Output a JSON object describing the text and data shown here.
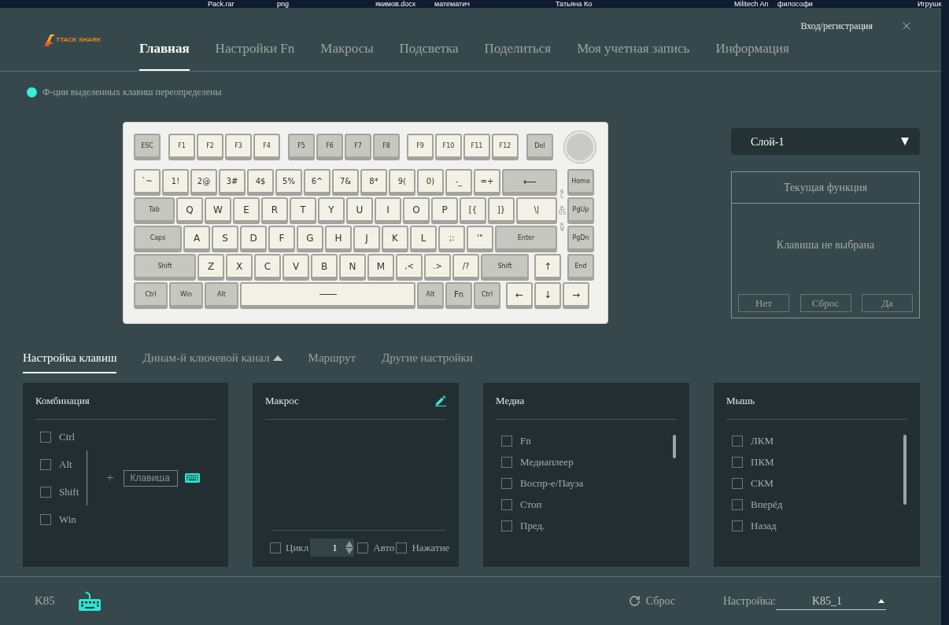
{
  "desktop": {
    "icon_labels": [
      "Pack.rar",
      "png",
      "якимов.docx",
      "математич",
      "Татьяна Ко",
      "Militech An",
      "философи",
      "Игрушк"
    ]
  },
  "header": {
    "logo": "TTACK SHARK",
    "tabs": [
      {
        "label": "Главная",
        "selected": true
      },
      {
        "label": "Настройки Fn",
        "selected": false
      },
      {
        "label": "Макросы",
        "selected": false
      },
      {
        "label": "Подсветка",
        "selected": false
      },
      {
        "label": "Поделиться",
        "selected": false
      },
      {
        "label": "Моя учетная запись",
        "selected": false
      },
      {
        "label": "Информация",
        "selected": false
      }
    ],
    "login": "Вход/регистрация"
  },
  "legend": "Ф-ции выделенных клавиш переопределены",
  "keyboard": {
    "function_row": [
      {
        "label": "ESC",
        "color": "#c7c7c1"
      },
      {
        "label": "F1",
        "color": "#f2f1e6"
      },
      {
        "label": "F2",
        "color": "#f2f1e6"
      },
      {
        "label": "F3",
        "color": "#f2f1e6"
      },
      {
        "label": "F4",
        "color": "#f2f1e6"
      },
      {
        "label": "F5",
        "color": "#c7c7c1"
      },
      {
        "label": "F6",
        "color": "#c7c7c1"
      },
      {
        "label": "F7",
        "color": "#c7c7c1"
      },
      {
        "label": "F8",
        "color": "#c7c7c1"
      },
      {
        "label": "F9",
        "color": "#f2f1e6"
      },
      {
        "label": "F10",
        "color": "#f2f1e6"
      },
      {
        "label": "F11",
        "color": "#f2f1e6"
      },
      {
        "label": "F12",
        "color": "#f2f1e6"
      },
      {
        "label": "Del",
        "color": "#c7c7c1"
      }
    ],
    "main_rows": [
      [
        {
          "label": "`~",
          "color": "#f2f1e6"
        },
        {
          "label": "1!",
          "color": "#f2f1e6"
        },
        {
          "label": "2@",
          "color": "#f2f1e6"
        },
        {
          "label": "3#",
          "color": "#f2f1e6"
        },
        {
          "label": "4$",
          "color": "#f2f1e6"
        },
        {
          "label": "5%",
          "color": "#f2f1e6"
        },
        {
          "label": "6^",
          "color": "#f2f1e6"
        },
        {
          "label": "7&",
          "color": "#f2f1e6"
        },
        {
          "label": "8*",
          "color": "#f2f1e6"
        },
        {
          "label": "9(",
          "color": "#f2f1e6"
        },
        {
          "label": "0)",
          "color": "#f2f1e6"
        },
        {
          "label": "-_",
          "color": "#f2f1e6"
        },
        {
          "label": "=+",
          "color": "#f2f1e6"
        },
        {
          "label": "⟵",
          "color": "#c7c7c1"
        }
      ],
      [
        {
          "label": "Tab",
          "color": "#c7c7c1"
        },
        {
          "label": "Q",
          "color": "#f2f1e6"
        },
        {
          "label": "W",
          "color": "#f2f1e6"
        },
        {
          "label": "E",
          "color": "#f2f1e6"
        },
        {
          "label": "R",
          "color": "#f2f1e6"
        },
        {
          "label": "T",
          "color": "#f2f1e6"
        },
        {
          "label": "Y",
          "color": "#f2f1e6"
        },
        {
          "label": "U",
          "color": "#f2f1e6"
        },
        {
          "label": "I",
          "color": "#f2f1e6"
        },
        {
          "label": "O",
          "color": "#f2f1e6"
        },
        {
          "label": "P",
          "color": "#f2f1e6"
        },
        {
          "label": "[{",
          "color": "#f2f1e6"
        },
        {
          "label": "]}",
          "color": "#f2f1e6"
        },
        {
          "label": "\\|",
          "color": "#f2f1e6"
        }
      ],
      [
        {
          "label": "Caps",
          "color": "#c7c7c1"
        },
        {
          "label": "A",
          "color": "#f2f1e6"
        },
        {
          "label": "S",
          "color": "#f2f1e6"
        },
        {
          "label": "D",
          "color": "#f2f1e6"
        },
        {
          "label": "F",
          "color": "#f2f1e6"
        },
        {
          "label": "G",
          "color": "#f2f1e6"
        },
        {
          "label": "H",
          "color": "#f2f1e6"
        },
        {
          "label": "J",
          "color": "#f2f1e6"
        },
        {
          "label": "K",
          "color": "#f2f1e6"
        },
        {
          "label": "L",
          "color": "#f2f1e6"
        },
        {
          "label": ";:",
          "color": "#f2f1e6"
        },
        {
          "label": "'\"",
          "color": "#f2f1e6"
        },
        {
          "label": "Enter",
          "color": "#c7c7c1"
        }
      ],
      [
        {
          "label": "Shift",
          "color": "#c7c7c1"
        },
        {
          "label": "Z",
          "color": "#f2f1e6"
        },
        {
          "label": "X",
          "color": "#f2f1e6"
        },
        {
          "label": "C",
          "color": "#f2f1e6"
        },
        {
          "label": "V",
          "color": "#f2f1e6"
        },
        {
          "label": "B",
          "color": "#f2f1e6"
        },
        {
          "label": "N",
          "color": "#f2f1e6"
        },
        {
          "label": "M",
          "color": "#f2f1e6"
        },
        {
          "label": ",<",
          "color": "#f2f1e6"
        },
        {
          "label": ".>",
          "color": "#f2f1e6"
        },
        {
          "label": "/?",
          "color": "#f2f1e6"
        },
        {
          "label": "Shift",
          "color": "#c7c7c1"
        }
      ],
      [
        {
          "label": "Ctrl",
          "color": "#c7c7c1"
        },
        {
          "label": "Win",
          "color": "#c7c7c1"
        },
        {
          "label": "Alt",
          "color": "#c7c7c1"
        },
        {
          "color": "#f2f1e6"
        },
        {
          "label": "Alt",
          "color": "#c7c7c1"
        },
        {
          "label": "Fn",
          "color": "#c7c7c1"
        },
        {
          "label": "Ctrl",
          "color": "#c7c7c1"
        }
      ]
    ],
    "arrow_keys": [
      {
        "label": "↑",
        "color": "#f2f1e6"
      },
      {
        "label": "←",
        "color": "#f2f1e6"
      },
      {
        "label": "↓",
        "color": "#f2f1e6"
      },
      {
        "label": "→",
        "color": "#f2f1e6"
      }
    ],
    "nav_keys": [
      {
        "label": "Home",
        "color": "#c7c7c1"
      },
      {
        "label": "PgUp",
        "color": "#c7c7c1"
      },
      {
        "label": "PgDn",
        "color": "#c7c7c1"
      },
      {
        "label": "End",
        "color": "#c7c7c1"
      }
    ],
    "indicators": [
      "C",
      "OS",
      "W"
    ]
  },
  "layer_select": {
    "value": "Слой-1"
  },
  "current_function": {
    "title": "Текущая функция",
    "status": "Клавиша не выбрана",
    "buttons": [
      "Нет",
      "Сброс",
      "Да"
    ]
  },
  "subtabs": [
    {
      "label": "Настройка клавиш",
      "selected": true
    },
    {
      "label": "Динам-й ключевой канал",
      "selected": false
    },
    {
      "label": "Маршрут",
      "selected": false
    },
    {
      "label": "Другие настройки",
      "selected": false
    }
  ],
  "panels": {
    "combination": {
      "title": "Комбинация",
      "modifiers": [
        {
          "label": "Ctrl",
          "checked": false
        },
        {
          "label": "Alt",
          "checked": false
        },
        {
          "label": "Shift",
          "checked": false
        },
        {
          "label": "Win",
          "checked": false
        }
      ],
      "plus": "+",
      "key_field": {
        "placeholder": "Клавиша"
      }
    },
    "macro": {
      "title": "Макрос",
      "loop": {
        "label": "Цикл",
        "checked": false
      },
      "count": "1",
      "options": [
        {
          "label": "Авто",
          "checked": false
        },
        {
          "label": "Нажатие",
          "checked": false
        }
      ]
    },
    "media": {
      "title": "Медиа",
      "items": [
        {
          "label": "Fn",
          "checked": false
        },
        {
          "label": "Медиаплеер",
          "checked": false
        },
        {
          "label": "Воспр-е/Пауза",
          "checked": false
        },
        {
          "label": "Стоп",
          "checked": false
        },
        {
          "label": "Пред.",
          "checked": false
        }
      ]
    },
    "mouse": {
      "title": "Мышь",
      "items": [
        {
          "label": "ЛКМ",
          "checked": false
        },
        {
          "label": "ПКМ",
          "checked": false
        },
        {
          "label": "СКМ",
          "checked": false
        },
        {
          "label": "Вперёд",
          "checked": false
        },
        {
          "label": "Назад",
          "checked": false
        }
      ]
    }
  },
  "footer": {
    "model": "K85",
    "reset": "Сброс",
    "profile_label": "Настройка:",
    "profile": "K85_1"
  }
}
